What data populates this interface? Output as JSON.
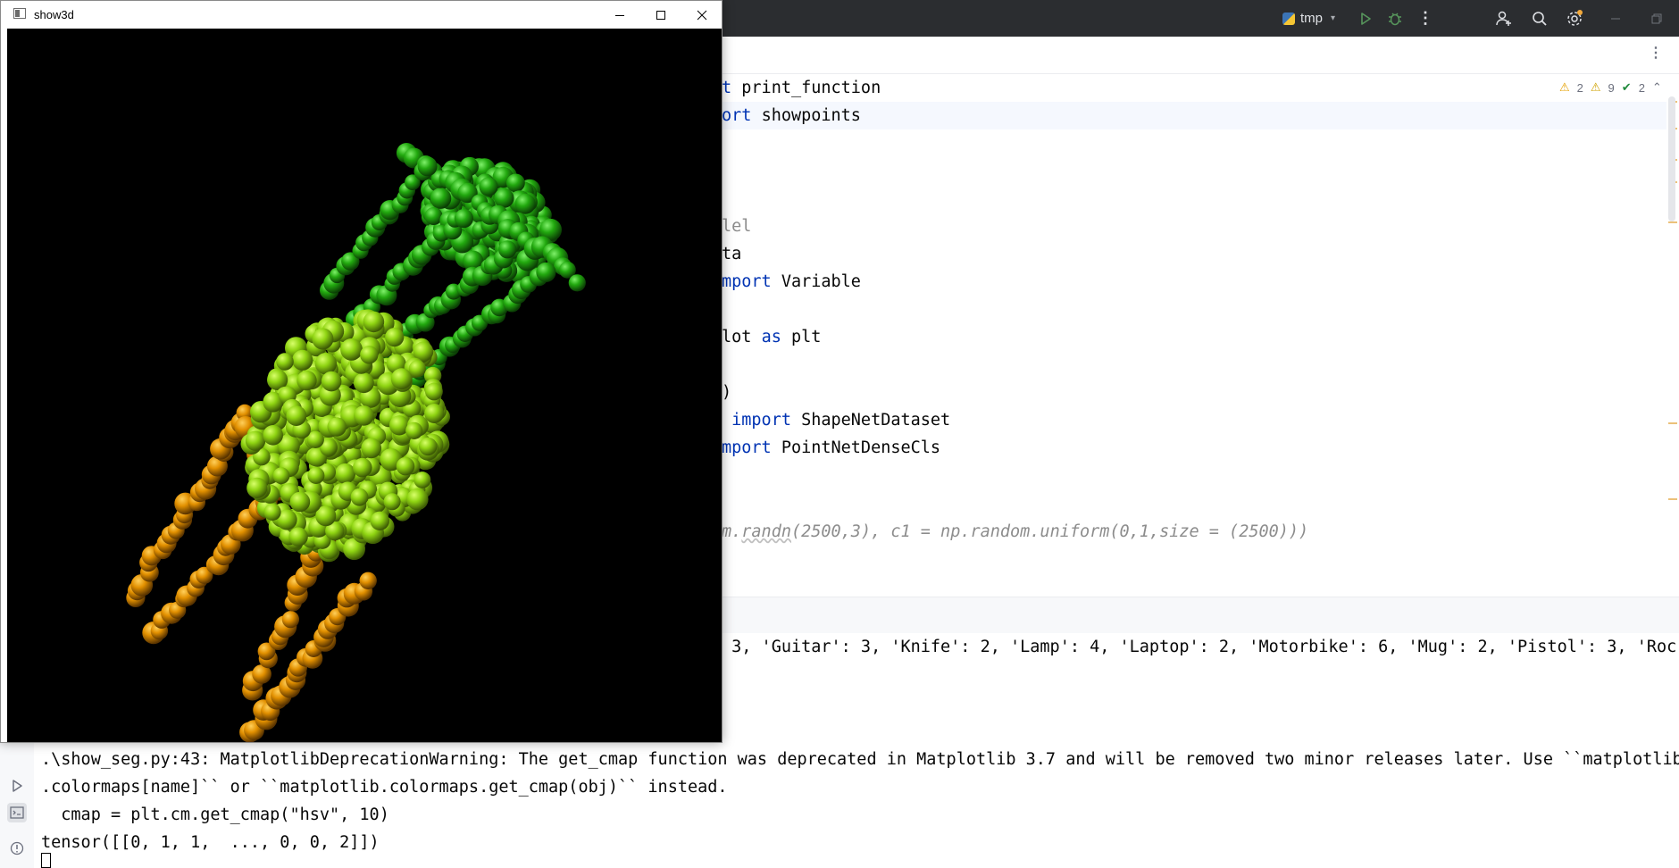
{
  "ide": {
    "run_config": "tmp",
    "inspections": {
      "warnings": "2",
      "weak_warnings": "9",
      "ok": "2"
    },
    "code_lines": [
      {
        "k1": "t ",
        "rest": "print_function"
      },
      {
        "k1": "ort ",
        "rest": "showpoints"
      },
      {
        "dim": "lel"
      },
      {
        "text": "ta"
      },
      {
        "k1": "mport ",
        "rest": "Variable"
      },
      {
        "pre": "lot ",
        "k1": "as ",
        "rest": "plt"
      },
      {
        "text": ")"
      },
      {
        "k1": " import ",
        "rest": "ShapeNetDataset"
      },
      {
        "k1": "mport ",
        "rest": "PointNetDenseCls"
      },
      {
        "cm1": "m.",
        "cm2": "randn",
        "cm3": "(2500,3), c1 = np.random.uniform(0,1,size = (2500)))"
      }
    ],
    "console_lines": [
      " 3, 'Guitar': 3, 'Knife': 2, 'Lamp': 4, 'Laptop': 2, 'Motorbike': 6, 'Mug': 2, 'Pistol': 3, 'Roc",
      ".\\show_seg.py:43: MatplotlibDeprecationWarning: The get_cmap function was deprecated in Matplotlib 3.7 and will be removed two minor releases later. Use ``matplotlib",
      ".colormaps[name]`` or ``matplotlib.colormaps.get_cmap(obj)`` instead.",
      "  cmap = plt.cm.get_cmap(\"hsv\", 10)",
      "tensor([[0, 1, 1,  ..., 0, 0, 2]])"
    ]
  },
  "show3d": {
    "title": "show3d",
    "background": "#000000",
    "colors": {
      "back": "#1e9a0c",
      "seat": "#86d210",
      "legs": "#e39300"
    }
  },
  "icons": {
    "run": "run-icon",
    "debug": "debug-icon",
    "more": "more-vertical-icon",
    "user": "add-user-icon",
    "search": "search-icon",
    "settings": "gear-icon",
    "minimize": "minimize-icon",
    "maximize": "maximize-icon",
    "close": "close-icon"
  }
}
